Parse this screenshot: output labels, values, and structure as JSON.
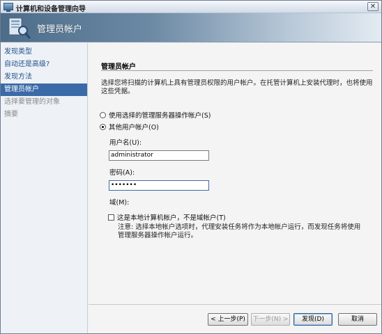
{
  "window": {
    "title": "计算机和设备管理向导"
  },
  "banner": {
    "title": "管理员帐户",
    "icon": "computer-search-icon"
  },
  "nav": {
    "items": [
      {
        "label": "发现类型",
        "state": "normal"
      },
      {
        "label": "自动还是高级?",
        "state": "normal"
      },
      {
        "label": "发现方法",
        "state": "normal"
      },
      {
        "label": "管理员帐户",
        "state": "active"
      },
      {
        "label": "选择要管理的对象",
        "state": "disabled"
      },
      {
        "label": "摘要",
        "state": "disabled"
      }
    ]
  },
  "main": {
    "section_title": "管理员帐户",
    "description": "选择您将扫描的计算机上具有管理员权限的用户帐户。在托管计算机上安装代理时，也将使用这些凭据。",
    "radio_action_account": "使用选择的管理服务器操作帐户(S)",
    "radio_other_account": "其他用户帐户(O)",
    "username_label": "用户名(U):",
    "username_value": "administrator",
    "password_label": "密码(A):",
    "password_value": "•••••••",
    "domain_label": "域(M):",
    "local_checkbox_label": "这是本地计算机帐户，不是域帐户(T)",
    "note": "注意: 选择本地帐户选项时，代理安装任务将作为本地帐户运行，而发现任务将使用管理服务器操作帐户运行。"
  },
  "buttons": {
    "back": "< 上一步(P)",
    "next": "下一步(N) >",
    "discover": "发现(D)",
    "cancel": "取消"
  },
  "colors": {
    "accent": "#3a6aa7",
    "nav_link": "#1f4f8a"
  }
}
